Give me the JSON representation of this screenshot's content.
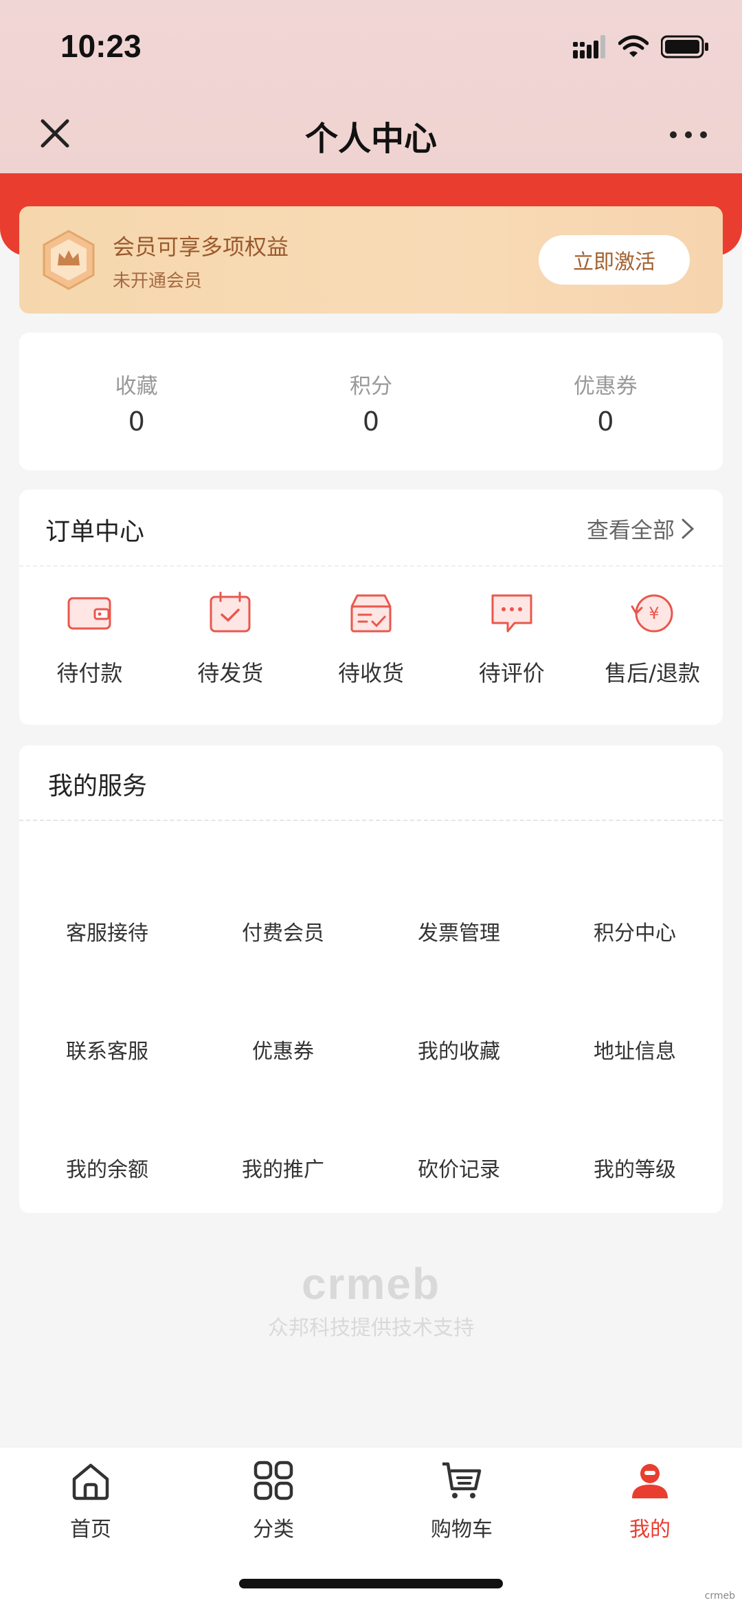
{
  "status": {
    "time": "10:23"
  },
  "nav": {
    "title": "个人中心"
  },
  "member": {
    "title": "会员可享多项权益",
    "subtitle": "未开通会员",
    "button": "立即激活"
  },
  "stats": [
    {
      "label": "收藏",
      "value": "0"
    },
    {
      "label": "积分",
      "value": "0"
    },
    {
      "label": "优惠券",
      "value": "0"
    }
  ],
  "orders": {
    "title": "订单中心",
    "view_all": "查看全部",
    "items": [
      {
        "label": "待付款",
        "icon": "wallet-icon"
      },
      {
        "label": "待发货",
        "icon": "calendar-check-icon"
      },
      {
        "label": "待收货",
        "icon": "box-check-icon"
      },
      {
        "label": "待评价",
        "icon": "chat-dots-icon"
      },
      {
        "label": "售后/退款",
        "icon": "refund-icon"
      }
    ]
  },
  "services": {
    "title": "我的服务",
    "items": [
      "客服接待",
      "付费会员",
      "发票管理",
      "积分中心",
      "联系客服",
      "优惠券",
      "我的收藏",
      "地址信息",
      "我的余额",
      "我的推广",
      "砍价记录",
      "我的等级"
    ]
  },
  "brand": {
    "logo": "crmeb",
    "text": "众邦科技提供技术支持"
  },
  "tabs": [
    {
      "label": "首页",
      "icon": "home-icon"
    },
    {
      "label": "分类",
      "icon": "grid-icon"
    },
    {
      "label": "购物车",
      "icon": "cart-icon"
    },
    {
      "label": "我的",
      "icon": "user-icon"
    }
  ],
  "watermark": "crmeb",
  "colors": {
    "accent": "#e93d30",
    "member_text": "#9a5a2e",
    "icon_red": "#e9574d"
  }
}
